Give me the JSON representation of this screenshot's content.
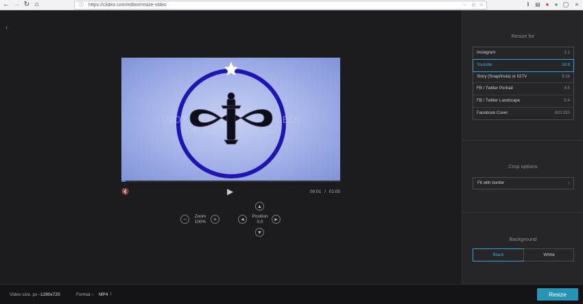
{
  "browser": {
    "url": "https://clideo.com/editor/resize-video",
    "more_icon": "more-icon",
    "shield_icon": "shield-icon",
    "star_icon": "star-icon"
  },
  "player": {
    "current_time": "00:01",
    "separator": "/",
    "duration": "01:05",
    "progress": 0.02,
    "watermark_line1": "(NOT TO BE REPRODUCED)",
    "watermark_line2": "(OR REPRODUCED)"
  },
  "controls": {
    "zoom_label": "Zoom",
    "zoom_value": "100%",
    "position_label": "Position",
    "position_value": "0,0"
  },
  "sidebar": {
    "resize_title": "Resize for",
    "presets": [
      {
        "name": "Instagram",
        "ratio": "1:1"
      },
      {
        "name": "Youtube",
        "ratio": "16:9",
        "active": true
      },
      {
        "name": "Story (Snap/Insta) or IGTV",
        "ratio": "9:16"
      },
      {
        "name": "FB / Twitter Portrait",
        "ratio": "4:5"
      },
      {
        "name": "FB / Twitter Landscape",
        "ratio": "5:4"
      },
      {
        "name": "Facebook Cover",
        "ratio": "820:320"
      }
    ],
    "crop_title": "Crop options",
    "crop_value": "Fit with border",
    "background_title": "Background",
    "bg_black": "Black",
    "bg_white": "White"
  },
  "bottom": {
    "video_size_label": "Video size, px –",
    "video_size_value": "1280x720",
    "format_label": "Format –",
    "format_value": "MP4",
    "resize_button": "Resize"
  },
  "colors": {
    "accent": "#2694b3",
    "active_blue": "#3ba9e0",
    "ring": "#1f15b3"
  }
}
